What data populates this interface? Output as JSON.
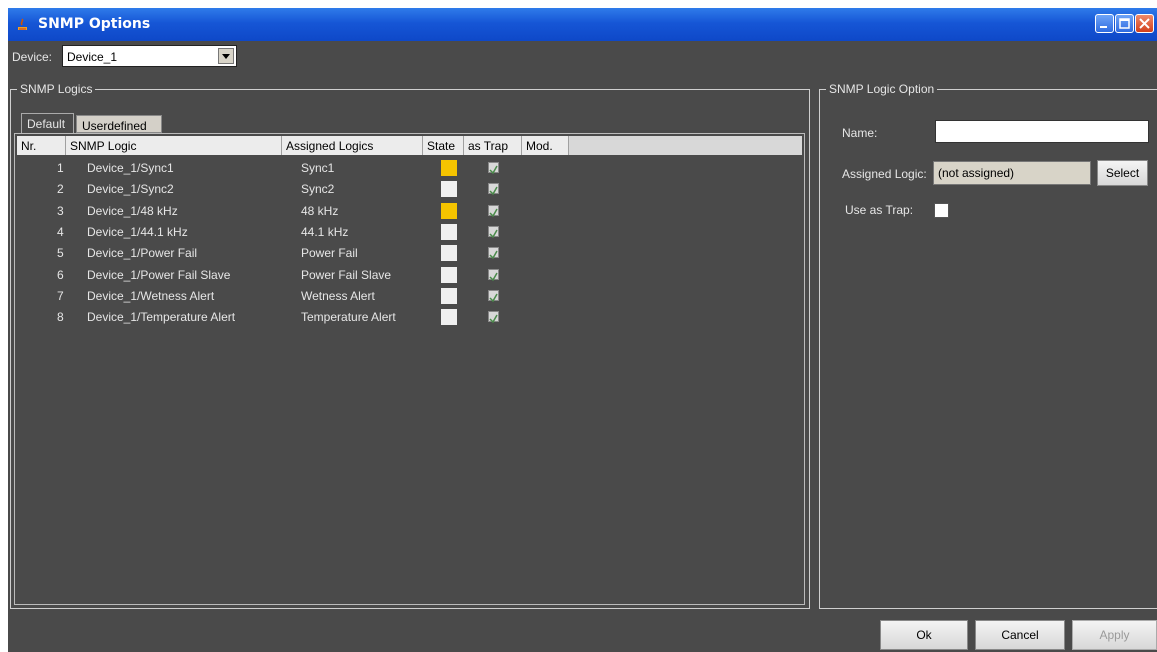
{
  "window": {
    "title": "SNMP Options"
  },
  "device": {
    "label": "Device:",
    "value": "Device_1"
  },
  "logics_group": {
    "title": "SNMP Logics",
    "tabs": [
      {
        "label": "Default"
      },
      {
        "label": "Userdefined"
      }
    ],
    "columns": [
      "Nr.",
      "SNMP Logic",
      "Assigned Logics",
      "State",
      "as Trap",
      "Mod."
    ],
    "rows": [
      {
        "nr": "1",
        "logic": "Device_1/Sync1",
        "assigned": "Sync1",
        "state": "active",
        "as_trap": true
      },
      {
        "nr": "2",
        "logic": "Device_1/Sync2",
        "assigned": "Sync2",
        "state": "inactive",
        "as_trap": true
      },
      {
        "nr": "3",
        "logic": "Device_1/48 kHz",
        "assigned": "48 kHz",
        "state": "active",
        "as_trap": true
      },
      {
        "nr": "4",
        "logic": "Device_1/44.1 kHz",
        "assigned": "44.1 kHz",
        "state": "inactive",
        "as_trap": true
      },
      {
        "nr": "5",
        "logic": "Device_1/Power Fail",
        "assigned": "Power Fail",
        "state": "inactive",
        "as_trap": true
      },
      {
        "nr": "6",
        "logic": "Device_1/Power Fail Slave",
        "assigned": "Power Fail Slave",
        "state": "inactive",
        "as_trap": true
      },
      {
        "nr": "7",
        "logic": "Device_1/Wetness Alert",
        "assigned": "Wetness Alert",
        "state": "inactive",
        "as_trap": true
      },
      {
        "nr": "8",
        "logic": "Device_1/Temperature Alert",
        "assigned": "Temperature Alert",
        "state": "inactive",
        "as_trap": true
      }
    ]
  },
  "option_group": {
    "title": "SNMP Logic Option",
    "name_label": "Name:",
    "name_value": "",
    "assigned_label": "Assigned Logic:",
    "assigned_value": "(not assigned)",
    "select_label": "Select",
    "trap_label": "Use as Trap:",
    "trap_checked": false
  },
  "footer": {
    "ok": "Ok",
    "cancel": "Cancel",
    "apply": "Apply"
  },
  "colors": {
    "state_active": "#f5c400",
    "state_inactive": "#f0f0f0",
    "background": "#4a4a4a",
    "titlebar": "#1656d6"
  },
  "icons": {
    "app": "java-cup-icon",
    "minimize": "minimize-icon",
    "maximize": "maximize-icon",
    "close": "close-icon"
  }
}
